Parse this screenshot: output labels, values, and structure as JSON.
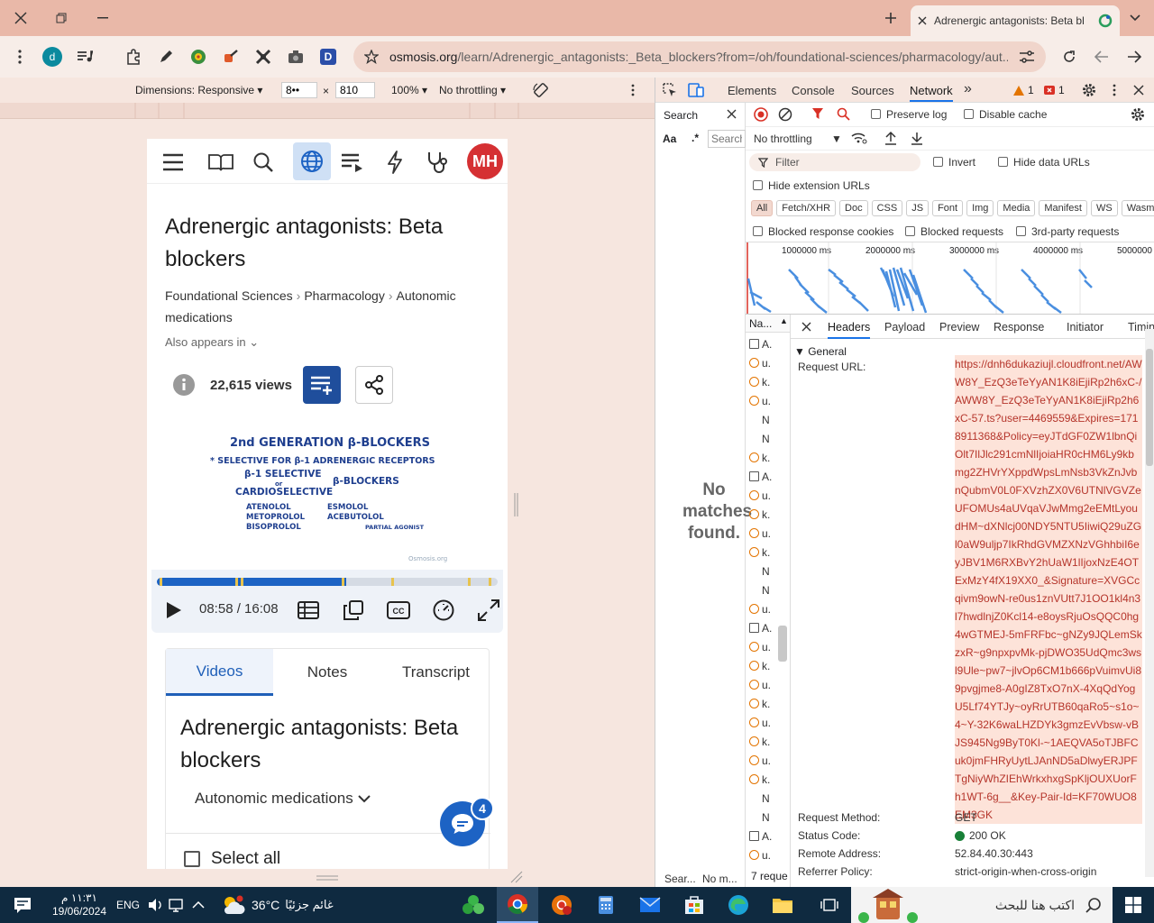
{
  "browser": {
    "tab_title": "Adrenergic antagonists: Beta bl",
    "url_domain": "osmosis.org",
    "url_path": "/learn/Adrenergic_antagonists:_Beta_blockers?from=/oh/foundational-sciences/pharmacology/aut..."
  },
  "device_toolbar": {
    "dimensions": "Dimensions: Responsive",
    "width_value": "8••",
    "times": "×",
    "height_value": "810",
    "zoom": "100%",
    "throttling": "No throttling"
  },
  "page": {
    "avatar_initials": "MH",
    "title": "Adrenergic antagonists: Beta blockers",
    "breadcrumb": [
      "Foundational Sciences",
      "Pharmacology",
      "Autonomic medications"
    ],
    "also_appears": "Also appears in",
    "views": "22,615 views",
    "slide": {
      "heading": "2nd GENERATION   β-BLOCKERS",
      "line1": "* SELECTIVE FOR  β-1 ADRENERGIC RECEPTORS",
      "line2": "β-1 SELECTIVE",
      "line3": "or",
      "line4": "CARDIOSELECTIVE",
      "line5": "β-BLOCKERS",
      "col1": [
        "ATENOLOL",
        "METOPROLOL",
        "BISOPROLOL"
      ],
      "col2": [
        "ESMOLOL",
        "ACEBUTOLOL"
      ],
      "note": "PARTIAL AGONIST",
      "watermark": "Osmosis.org"
    },
    "player": {
      "timecode": "08:58 / 16:08",
      "progress": 0.556
    },
    "tabs": [
      "Videos",
      "Notes",
      "Transcript"
    ],
    "card_title": "Adrenergic antagonists: Beta blockers",
    "card_subtitle": "Autonomic medications",
    "select_all": "Select all",
    "chat_badge": "4"
  },
  "devtools": {
    "tabs": [
      "Elements",
      "Console",
      "Sources",
      "Network"
    ],
    "warn_count": "1",
    "err_count": "1",
    "search_label": "Search",
    "search_aa": "Aa",
    "search_regex": ".*",
    "search_placeholder": "Search",
    "no_matches": "No matches found.",
    "search_footer": "Sear...",
    "search_footer2": "No m...",
    "preserve_log": "Preserve log",
    "disable_cache": "Disable cache",
    "throttling": "No throttling",
    "filter_placeholder": "Filter",
    "invert": "Invert",
    "hide_data_urls": "Hide data URLs",
    "hide_ext_urls": "Hide extension URLs",
    "type_filters": [
      "All",
      "Fetch/XHR",
      "Doc",
      "CSS",
      "JS",
      "Font",
      "Img",
      "Media",
      "Manifest",
      "WS",
      "Wasm"
    ],
    "blocked_cookies": "Blocked response cookies",
    "blocked_requests": "Blocked requests",
    "third_party": "3rd-party requests",
    "timeline_ticks": [
      "1000000 ms",
      "2000000 ms",
      "3000000 ms",
      "4000000 ms",
      "5000000"
    ],
    "name_col": "Na...",
    "requests_footer": "7 reque",
    "request_items": [
      "A.",
      "u.",
      "k.",
      "u.",
      "N",
      "N",
      "k.",
      "A.",
      "u.",
      "k.",
      "u.",
      "k.",
      "N",
      "N",
      "u.",
      "A.",
      "u.",
      "k.",
      "u.",
      "k.",
      "u.",
      "k.",
      "u.",
      "k.",
      "N",
      "N",
      "A.",
      "u."
    ],
    "detail_tabs": [
      "Headers",
      "Payload",
      "Preview",
      "Response",
      "Initiator",
      "Timing"
    ],
    "general": "General",
    "request_url_label": "Request URL:",
    "request_url": "https://dnh6dukaziujl.cloudfront.net/AWW8Y_EzQ3eTeYyAN1K8iEjiRp2h6xC-/AWW8Y_EzQ3eTeYyAN1K8iEjiRp2h6xC-57.ts?user=4469559&Expires=1718911368&Policy=eyJTdGF0ZW1lbnQiOlt7IlJlc291cmNlIjoiaHR0cHM6Ly9kbmg2ZHVrYXppdWpsLmNsb3VkZnJvbnQubmV0L0FXVzhZX0V6UTNlVGVZeUFOMUs4aUVqaVJwMmg2eEMtLyoudHM~dXNlcj00NDY5NTU5IiwiQ29uZGl0aW9uljp7IkRhdGVMZXNzVGhhbiI6eyJBV1M6RXBvY2hUaW1lIjoxNzE4OTExMzY4fX19XX0_&Signature=XVGCcqivm9owN-re0us1znVUtt7J1OO1kl4n3l7hwdlnjZ0Kcl14-e8oysRjuOsQQC0hg4wGTMEJ-5mFRFbc~gNZy9JQLemSkzxR~g9npxpvMk-pjDWO35UdQmc3wsl9Ule~pw7~jlvOp6CM1b666pVuimvUi89pvgjme8-A0gIZ8TxO7nX-4XqQdYogU5Lf74YTJy~oyRrUTB60qaRo5~s1o~4~Y-32K6waLHZDYk3gmzEvVbsw-vBJS945Ng9ByT0Kl-~1AEQVA5oTJBFCuk0jmFHRyUytLJAnND5aDlwyERJPFTgNiyWhZIEhWrkxhxgSpKljOUXUorFh1WT-6g__&Key-Pair-Id=KF70WUO8EM3GK",
    "request_method_label": "Request Method:",
    "request_method": "GET",
    "status_label": "Status Code:",
    "status": "200 OK",
    "remote_label": "Remote Address:",
    "remote": "52.84.40.30:443",
    "referrer_label": "Referrer Policy:",
    "referrer": "strict-origin-when-cross-origin"
  },
  "taskbar": {
    "time": "١١:٣١ م",
    "date": "19/06/2024",
    "lang": "ENG",
    "temperature": "36°C",
    "weather": "غائم جزئيًا",
    "search": "اكتب هنا للبحث"
  },
  "colors": {
    "accent": "#1d63c4",
    "avatar": "#d53033",
    "titlebar": "#e9b8a8",
    "url_highlight": "#fde3d9"
  }
}
